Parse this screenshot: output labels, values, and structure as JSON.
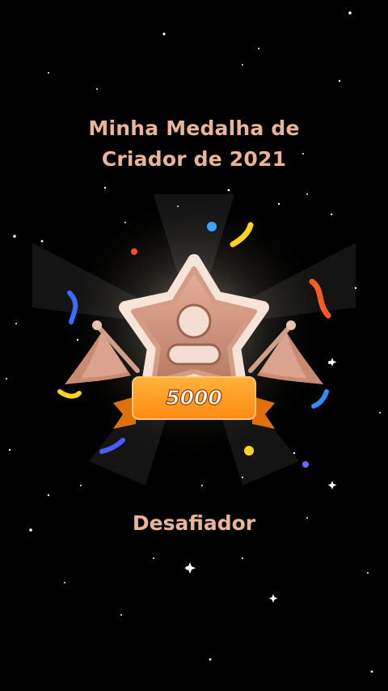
{
  "title_line1": "Minha Medalha de",
  "title_line2": "Criador de 2021",
  "badge": {
    "value": "5000",
    "icon": "creator-medal-icon"
  },
  "rank_label": "Desafiador",
  "colors": {
    "background": "#000000",
    "title_text": "#e8b49a",
    "ribbon": "#ff9a1f",
    "medal_bronze": "#c98a72"
  }
}
